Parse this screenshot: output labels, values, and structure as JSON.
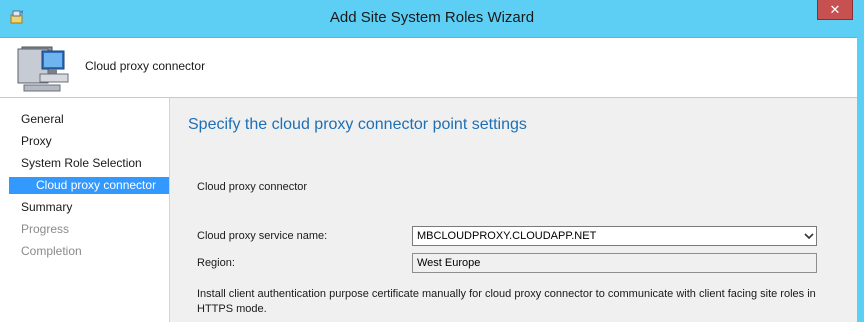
{
  "window": {
    "title": "Add Site System Roles Wizard",
    "close_label": "✕"
  },
  "header": {
    "title": "Cloud proxy connector",
    "icon": "computer-icon"
  },
  "nav": {
    "items": [
      {
        "label": "General",
        "state": "normal"
      },
      {
        "label": "Proxy",
        "state": "normal"
      },
      {
        "label": "System Role Selection",
        "state": "normal"
      },
      {
        "label": "Cloud proxy connector",
        "state": "selected"
      },
      {
        "label": "Summary",
        "state": "normal"
      },
      {
        "label": "Progress",
        "state": "disabled"
      },
      {
        "label": "Completion",
        "state": "disabled"
      }
    ]
  },
  "main": {
    "heading": "Specify the cloud proxy connector point settings",
    "section_label": "Cloud proxy connector",
    "service_name_label": "Cloud proxy service name:",
    "service_name_value": "MBCLOUDPROXY.CLOUDAPP.NET",
    "region_label": "Region:",
    "region_value": "West Europe",
    "info_text": "Install client authentication purpose certificate manually for cloud proxy connector to communicate with client facing site roles in HTTPS mode."
  },
  "colors": {
    "titlebar": "#5dcff5",
    "selected_nav": "#3399ff",
    "heading": "#1e6fb5",
    "close_button": "#c75050"
  }
}
